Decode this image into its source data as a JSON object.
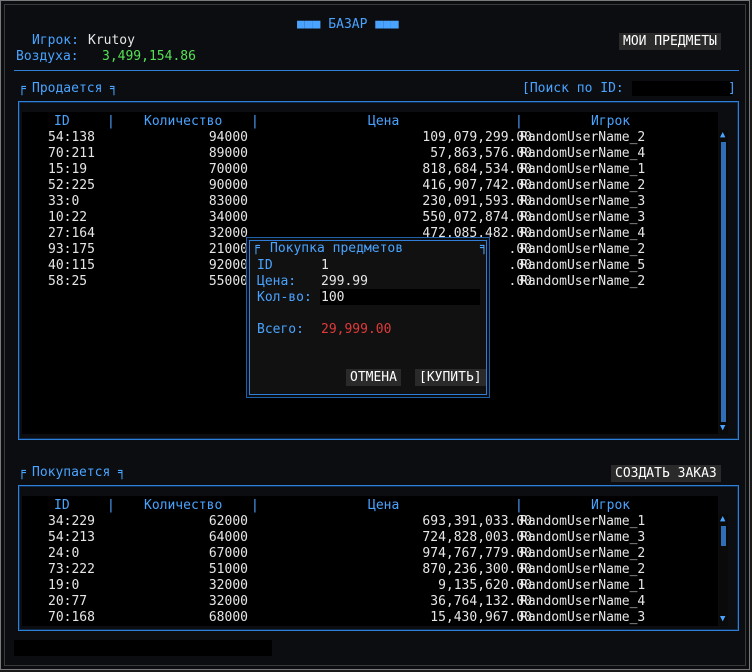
{
  "header": {
    "title": "■■■ БАЗАР ■■■",
    "player_label": "Игрок:",
    "player_name": "Krutoy",
    "air_label": "Воздуха:",
    "air_value": "3,499,154.86",
    "my_items_button": "МОИ ПРЕДМЕТЫ"
  },
  "selling": {
    "tab_label": "Продается",
    "search_label": "[Поиск по ID:",
    "search_value": "",
    "columns": [
      "ID",
      "Количество",
      "Цена",
      "Игрок"
    ],
    "rows": [
      {
        "id": "54:138",
        "qty": "94000",
        "price": "109,079,299.00",
        "player": "RandomUserName_2"
      },
      {
        "id": "70:211",
        "qty": "89000",
        "price": "57,863,576.00",
        "player": "RandomUserName_4"
      },
      {
        "id": "15:19",
        "qty": "70000",
        "price": "818,684,534.00",
        "player": "RandomUserName_1"
      },
      {
        "id": "52:225",
        "qty": "90000",
        "price": "416,907,742.00",
        "player": "RandomUserName_2"
      },
      {
        "id": "33:0",
        "qty": "83000",
        "price": "230,091,593.00",
        "player": "RandomUserName_3"
      },
      {
        "id": "10:22",
        "qty": "34000",
        "price": "550,072,874.00",
        "player": "RandomUserName_3"
      },
      {
        "id": "27:164",
        "qty": "32000",
        "price": "472,085,482.00",
        "player": "RandomUserName_4"
      },
      {
        "id": "93:175",
        "qty": "21000",
        "price": ".00",
        "player": "RandomUserName_2"
      },
      {
        "id": "40:115",
        "qty": "92000",
        "price": ".00",
        "player": "RandomUserName_5"
      },
      {
        "id": "58:25",
        "qty": "55000",
        "price": ".00",
        "player": "RandomUserName_2"
      }
    ]
  },
  "buying": {
    "tab_label": "Покупается",
    "create_order_button": "СОЗДАТЬ ЗАКАЗ",
    "columns": [
      "ID",
      "Количество",
      "Цена",
      "Игрок"
    ],
    "rows": [
      {
        "id": "34:229",
        "qty": "62000",
        "price": "693,391,033.00",
        "player": "RandomUserName_1"
      },
      {
        "id": "54:213",
        "qty": "64000",
        "price": "724,828,003.00",
        "player": "RandomUserName_3"
      },
      {
        "id": "24:0",
        "qty": "67000",
        "price": "974,767,779.00",
        "player": "RandomUserName_2"
      },
      {
        "id": "73:222",
        "qty": "51000",
        "price": "870,236,300.00",
        "player": "RandomUserName_2"
      },
      {
        "id": "19:0",
        "qty": "32000",
        "price": "9,135,620.00",
        "player": "RandomUserName_1"
      },
      {
        "id": "20:77",
        "qty": "32000",
        "price": "36,764,132.00",
        "player": "RandomUserName_4"
      },
      {
        "id": "70:168",
        "qty": "68000",
        "price": "15,430,967.00",
        "player": "RandomUserName_3"
      }
    ]
  },
  "purchase_dialog": {
    "title": "Покупка предметов",
    "id_label": "ID",
    "id_value": "1",
    "price_label": "Цена:",
    "price_value": "299.99",
    "qty_label": "Кол-во:",
    "qty_value": "100",
    "total_label": "Всего:",
    "total_value": "29,999.00",
    "cancel_button": "ОТМЕНА",
    "buy_button": "[КУПИТЬ]"
  },
  "colors": {
    "accent": "#2f7fd8",
    "label": "#4aa3ff",
    "money": "#55e055",
    "total": "#e03a3a"
  }
}
